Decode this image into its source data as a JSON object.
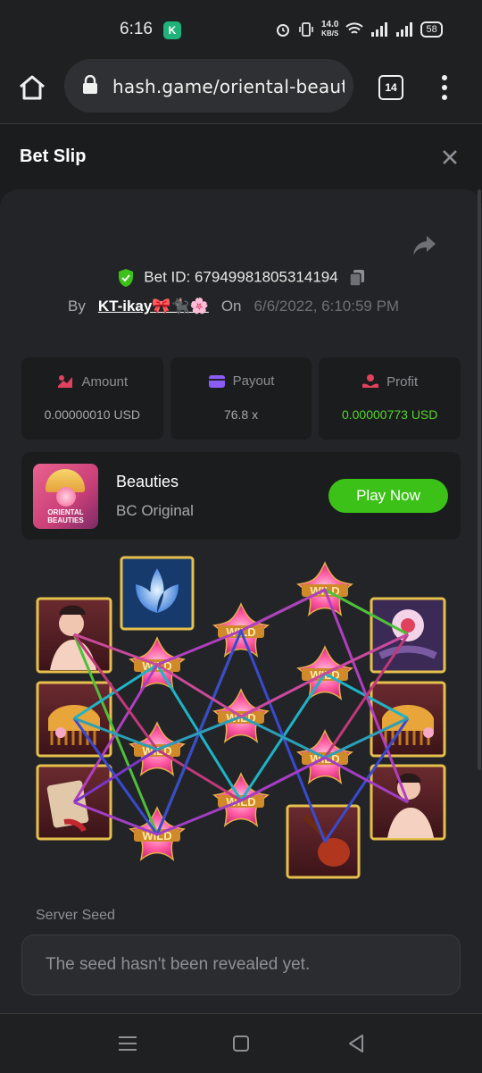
{
  "status_bar": {
    "time": "6:16",
    "app_badge": "K",
    "speed_value": "14.0",
    "speed_unit": "KB/S",
    "battery": "58"
  },
  "browser": {
    "url": "hash.game/oriental-beautie",
    "tab_count": "14"
  },
  "header": {
    "title": "Bet Slip"
  },
  "bet": {
    "id_label": "Bet ID: 67949981805314194",
    "by_label": "By",
    "user": "KT-ikay🎀🐈‍⬛🌸",
    "on_label": "On",
    "date": "6/6/2022, 6:10:59 PM"
  },
  "stats": [
    {
      "label": "Amount",
      "value": "0.00000010 USD",
      "icon": "amount-icon",
      "color": "#e0425e"
    },
    {
      "label": "Payout",
      "value": "76.8 x",
      "icon": "wallet-icon",
      "color": "#8b5cf6"
    },
    {
      "label": "Profit",
      "value": "0.00000773 USD",
      "icon": "profit-icon",
      "color": "#e0425e"
    }
  ],
  "game": {
    "thumb_text": "ORIENTAL BEAUTIES",
    "name": "Beauties",
    "provider": "BC Original",
    "play_label": "Play Now"
  },
  "seed": {
    "label": "Server Seed",
    "placeholder": "The seed hasn't been revealed yet."
  },
  "colors": {
    "accent_green": "#3bc117",
    "profit_green": "#54d62c",
    "panel": "#232427",
    "card": "#1b1c1e"
  }
}
